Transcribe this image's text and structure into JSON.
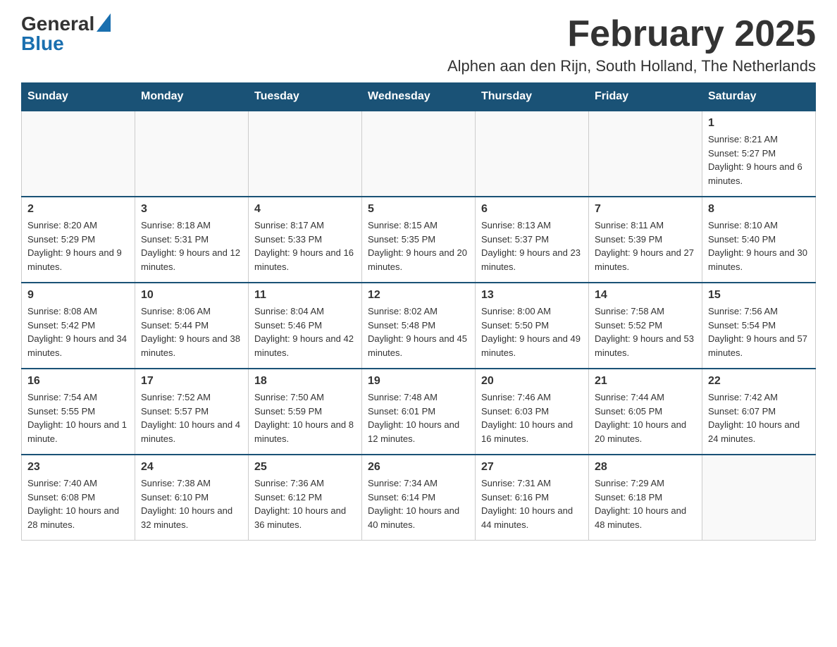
{
  "header": {
    "logo_general": "General",
    "logo_blue": "Blue",
    "month_title": "February 2025",
    "location": "Alphen aan den Rijn, South Holland, The Netherlands"
  },
  "days_of_week": [
    "Sunday",
    "Monday",
    "Tuesday",
    "Wednesday",
    "Thursday",
    "Friday",
    "Saturday"
  ],
  "weeks": [
    [
      {
        "day": "",
        "info": ""
      },
      {
        "day": "",
        "info": ""
      },
      {
        "day": "",
        "info": ""
      },
      {
        "day": "",
        "info": ""
      },
      {
        "day": "",
        "info": ""
      },
      {
        "day": "",
        "info": ""
      },
      {
        "day": "1",
        "info": "Sunrise: 8:21 AM\nSunset: 5:27 PM\nDaylight: 9 hours and 6 minutes."
      }
    ],
    [
      {
        "day": "2",
        "info": "Sunrise: 8:20 AM\nSunset: 5:29 PM\nDaylight: 9 hours and 9 minutes."
      },
      {
        "day": "3",
        "info": "Sunrise: 8:18 AM\nSunset: 5:31 PM\nDaylight: 9 hours and 12 minutes."
      },
      {
        "day": "4",
        "info": "Sunrise: 8:17 AM\nSunset: 5:33 PM\nDaylight: 9 hours and 16 minutes."
      },
      {
        "day": "5",
        "info": "Sunrise: 8:15 AM\nSunset: 5:35 PM\nDaylight: 9 hours and 20 minutes."
      },
      {
        "day": "6",
        "info": "Sunrise: 8:13 AM\nSunset: 5:37 PM\nDaylight: 9 hours and 23 minutes."
      },
      {
        "day": "7",
        "info": "Sunrise: 8:11 AM\nSunset: 5:39 PM\nDaylight: 9 hours and 27 minutes."
      },
      {
        "day": "8",
        "info": "Sunrise: 8:10 AM\nSunset: 5:40 PM\nDaylight: 9 hours and 30 minutes."
      }
    ],
    [
      {
        "day": "9",
        "info": "Sunrise: 8:08 AM\nSunset: 5:42 PM\nDaylight: 9 hours and 34 minutes."
      },
      {
        "day": "10",
        "info": "Sunrise: 8:06 AM\nSunset: 5:44 PM\nDaylight: 9 hours and 38 minutes."
      },
      {
        "day": "11",
        "info": "Sunrise: 8:04 AM\nSunset: 5:46 PM\nDaylight: 9 hours and 42 minutes."
      },
      {
        "day": "12",
        "info": "Sunrise: 8:02 AM\nSunset: 5:48 PM\nDaylight: 9 hours and 45 minutes."
      },
      {
        "day": "13",
        "info": "Sunrise: 8:00 AM\nSunset: 5:50 PM\nDaylight: 9 hours and 49 minutes."
      },
      {
        "day": "14",
        "info": "Sunrise: 7:58 AM\nSunset: 5:52 PM\nDaylight: 9 hours and 53 minutes."
      },
      {
        "day": "15",
        "info": "Sunrise: 7:56 AM\nSunset: 5:54 PM\nDaylight: 9 hours and 57 minutes."
      }
    ],
    [
      {
        "day": "16",
        "info": "Sunrise: 7:54 AM\nSunset: 5:55 PM\nDaylight: 10 hours and 1 minute."
      },
      {
        "day": "17",
        "info": "Sunrise: 7:52 AM\nSunset: 5:57 PM\nDaylight: 10 hours and 4 minutes."
      },
      {
        "day": "18",
        "info": "Sunrise: 7:50 AM\nSunset: 5:59 PM\nDaylight: 10 hours and 8 minutes."
      },
      {
        "day": "19",
        "info": "Sunrise: 7:48 AM\nSunset: 6:01 PM\nDaylight: 10 hours and 12 minutes."
      },
      {
        "day": "20",
        "info": "Sunrise: 7:46 AM\nSunset: 6:03 PM\nDaylight: 10 hours and 16 minutes."
      },
      {
        "day": "21",
        "info": "Sunrise: 7:44 AM\nSunset: 6:05 PM\nDaylight: 10 hours and 20 minutes."
      },
      {
        "day": "22",
        "info": "Sunrise: 7:42 AM\nSunset: 6:07 PM\nDaylight: 10 hours and 24 minutes."
      }
    ],
    [
      {
        "day": "23",
        "info": "Sunrise: 7:40 AM\nSunset: 6:08 PM\nDaylight: 10 hours and 28 minutes."
      },
      {
        "day": "24",
        "info": "Sunrise: 7:38 AM\nSunset: 6:10 PM\nDaylight: 10 hours and 32 minutes."
      },
      {
        "day": "25",
        "info": "Sunrise: 7:36 AM\nSunset: 6:12 PM\nDaylight: 10 hours and 36 minutes."
      },
      {
        "day": "26",
        "info": "Sunrise: 7:34 AM\nSunset: 6:14 PM\nDaylight: 10 hours and 40 minutes."
      },
      {
        "day": "27",
        "info": "Sunrise: 7:31 AM\nSunset: 6:16 PM\nDaylight: 10 hours and 44 minutes."
      },
      {
        "day": "28",
        "info": "Sunrise: 7:29 AM\nSunset: 6:18 PM\nDaylight: 10 hours and 48 minutes."
      },
      {
        "day": "",
        "info": ""
      }
    ]
  ]
}
